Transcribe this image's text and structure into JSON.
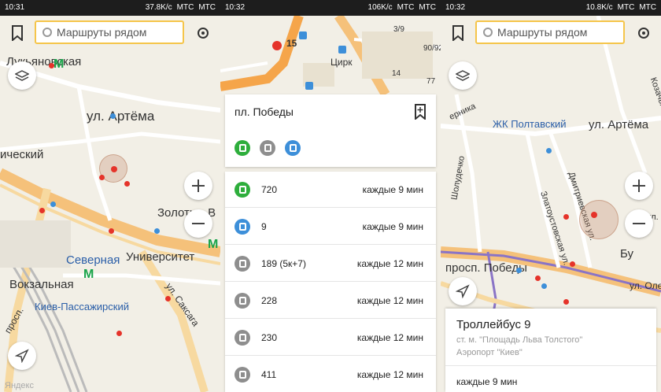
{
  "screens": [
    {
      "status": {
        "time": "10:31",
        "speed": "37.8K/c",
        "carrier1": "МТС",
        "carrier2": "МТС"
      },
      "search_placeholder": "Маршруты рядом",
      "labels": [
        "Лукьяновская",
        "ул. Артёма",
        "ический",
        "Золотые В",
        "Университет",
        "Северная",
        "Вокзальная",
        "Киев-Пассажирский",
        "просп.",
        "ул. Саксага"
      ],
      "watermark": "Яндекс"
    },
    {
      "status": {
        "time": "10:32",
        "speed": "106K/c",
        "carrier1": "МТС",
        "carrier2": "МТС"
      },
      "map_labels": {
        "circus": "Цирк",
        "stop_num": "15",
        "bld1": "3/9",
        "bld2": "90/92",
        "bld3": "14",
        "bld4": "77"
      },
      "stop": {
        "name": "пл. Победы"
      },
      "routes": [
        {
          "number": "720",
          "frequency": "каждые 9 мин",
          "type": "bus",
          "color": "#2eae3c"
        },
        {
          "number": "9",
          "frequency": "каждые 9 мин",
          "type": "trolleybus",
          "color": "#3d8fd9"
        },
        {
          "number": "189 (5к+7)",
          "frequency": "каждые 12 мин",
          "type": "bus",
          "color": "#8e8e8e"
        },
        {
          "number": "228",
          "frequency": "каждые 12 мин",
          "type": "bus",
          "color": "#8e8e8e"
        },
        {
          "number": "230",
          "frequency": "каждые 12 мин",
          "type": "bus",
          "color": "#8e8e8e"
        },
        {
          "number": "411",
          "frequency": "каждые 12 мин",
          "type": "bus",
          "color": "#8e8e8e"
        }
      ]
    },
    {
      "status": {
        "time": "10:32",
        "speed": "10.8K/c",
        "carrier1": "МТС",
        "carrier2": "МТС"
      },
      "search_placeholder": "Маршруты рядом",
      "labels": [
        "ЖК Полтавский",
        "ул. Артёма",
        "Дмитриевская ул.",
        "Златоустовская ул.",
        "просп. Победы",
        "ерника",
        "Бу",
        "ул. Олесо",
        "ул.",
        "Шолудечко",
        "Козачья"
      ],
      "info": {
        "title": "Троллейбус 9",
        "from": "ст. м. \"Площадь Льва Толстого\"",
        "to": "Аэропорт \"Киев\"",
        "frequency": "каждые 9 мин"
      }
    }
  ]
}
